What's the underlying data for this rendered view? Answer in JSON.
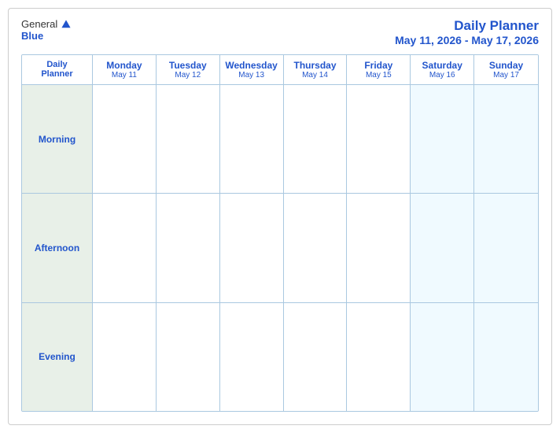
{
  "header": {
    "logo_general": "General",
    "logo_blue": "Blue",
    "title": "Daily Planner",
    "subtitle": "May 11, 2026 - May 17, 2026"
  },
  "calendar": {
    "first_col": {
      "label": "Daily",
      "label2": "Planner"
    },
    "columns": [
      {
        "day": "Monday",
        "date": "May 11"
      },
      {
        "day": "Tuesday",
        "date": "May 12"
      },
      {
        "day": "Wednesday",
        "date": "May 13"
      },
      {
        "day": "Thursday",
        "date": "May 14"
      },
      {
        "day": "Friday",
        "date": "May 15"
      },
      {
        "day": "Saturday",
        "date": "May 16"
      },
      {
        "day": "Sunday",
        "date": "May 17"
      }
    ],
    "rows": [
      {
        "label": "Morning"
      },
      {
        "label": "Afternoon"
      },
      {
        "label": "Evening"
      }
    ]
  }
}
